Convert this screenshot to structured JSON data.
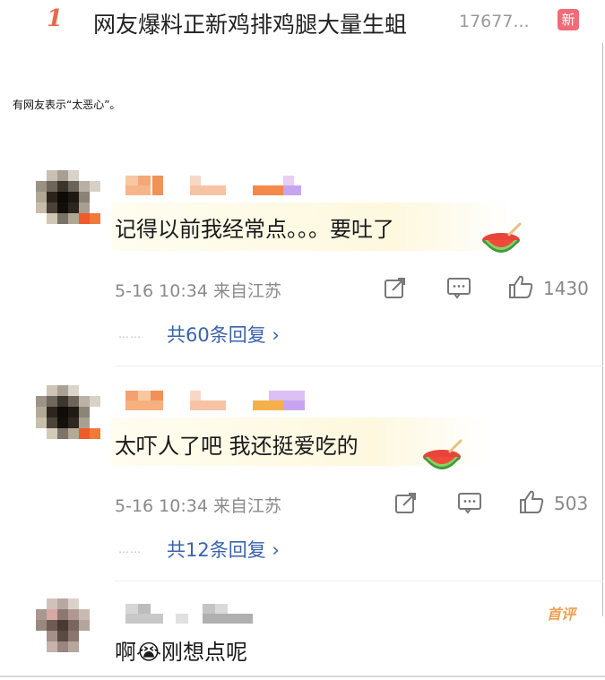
{
  "header": {
    "rank": "1",
    "headline": "网友爆料正新鸡排鸡腿大量生蛆",
    "count": "17677...",
    "badge": "新"
  },
  "caption": "有网友表示“太恶心”。",
  "comments": [
    {
      "text": "记得以前我经常点。。。要吐了",
      "time": "5-16 10:34",
      "location": "来自江苏",
      "likes": "1430",
      "replies": "共60条回复 ›"
    },
    {
      "text": "太吓人了吧  我还挺爱吃的",
      "time": "5-16 10:34",
      "location": "来自江苏",
      "likes": "503",
      "replies": "共12条回复 ›"
    },
    {
      "text": "啊😭刚想点呢",
      "tag": "首评"
    }
  ],
  "icons": {
    "share": "share-icon",
    "comment": "comment-icon",
    "like": "thumbs-up-icon",
    "emoji": "watermelon-emoji-icon"
  },
  "colors": {
    "rank": "#e86a4a",
    "badge": "#f06b78",
    "reply_link": "#3a63ad",
    "highlight": "#fdf8de",
    "first_tag": "#f0a050"
  }
}
